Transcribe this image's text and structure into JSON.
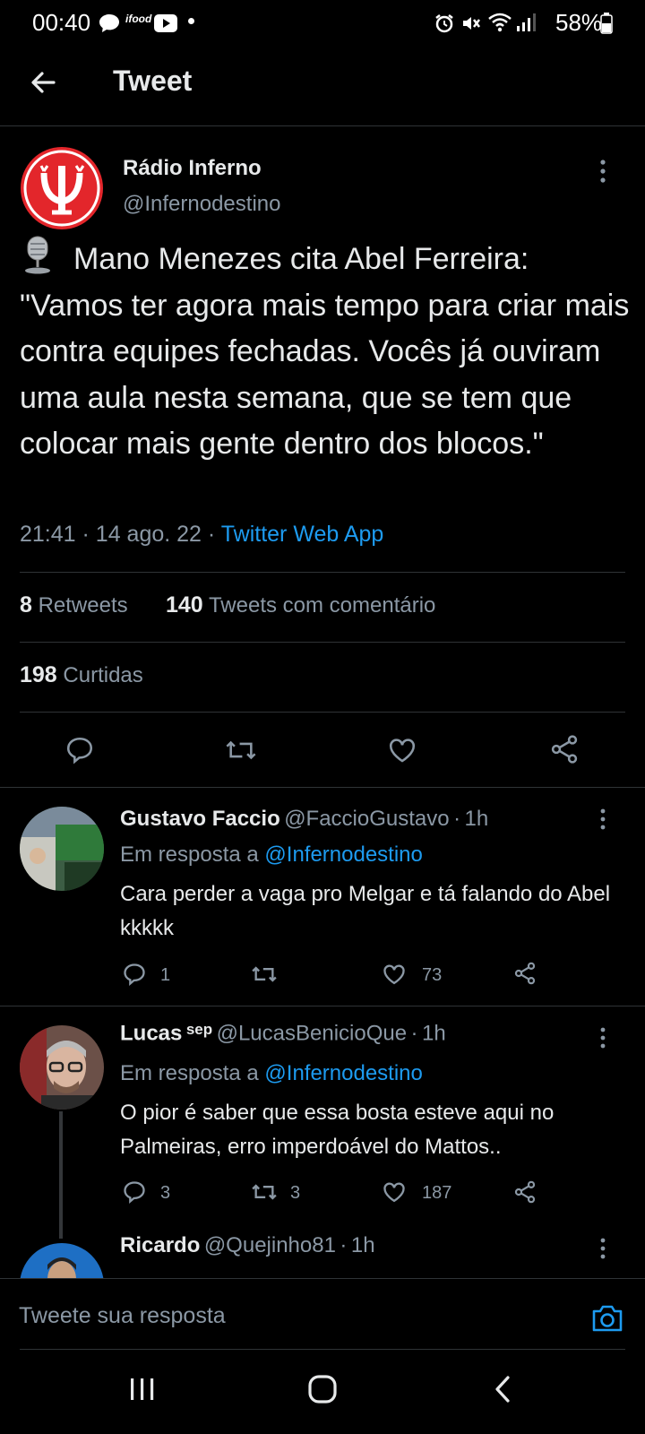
{
  "status_bar": {
    "time": "00:40",
    "battery": "58%"
  },
  "header": {
    "title": "Tweet"
  },
  "tweet": {
    "author_name": "Rádio Inferno",
    "author_handle": "@Infernodestino",
    "text": "Mano Menezes cita Abel Ferreira: \"Vamos ter agora mais tempo para criar mais contra equipes fechadas. Vocês já ouviram uma aula nesta semana, que se tem que colocar mais gente dentro dos blocos.\"",
    "time": "21:41",
    "date": "14 ago. 22",
    "source": "Twitter Web App",
    "retweets_count": "8",
    "retweets_label": "Retweets",
    "quotes_count": "140",
    "quotes_label": "Tweets com comentário",
    "likes_count": "198",
    "likes_label": "Curtidas"
  },
  "replies": [
    {
      "name": "Gustavo Faccio",
      "handle": "@FaccioGustavo",
      "time": "1h",
      "in_reply_prefix": "Em resposta a",
      "in_reply_to": "@Infernodestino",
      "text": "Cara perder a vaga pro Melgar e tá falando do Abel kkkkk",
      "reply_count": "1",
      "retweet_count": "",
      "like_count": "73"
    },
    {
      "name": "Lucas",
      "name_suffix": "sep",
      "handle": "@LucasBenicioQue",
      "time": "1h",
      "in_reply_prefix": "Em resposta a",
      "in_reply_to": "@Infernodestino",
      "text": "O pior é saber que essa bosta esteve aqui no Palmeiras, erro imperdoável do Mattos..",
      "reply_count": "3",
      "retweet_count": "3",
      "like_count": "187"
    },
    {
      "name": "Ricardo",
      "handle": "@Quejinho81",
      "time": "1h"
    }
  ],
  "compose": {
    "placeholder": "Tweete sua resposta"
  },
  "colors": {
    "background": "#000000",
    "accent": "#1d9bf0",
    "muted": "#8b98a5",
    "divider": "#2f3336",
    "logo_red": "#e3262b"
  }
}
